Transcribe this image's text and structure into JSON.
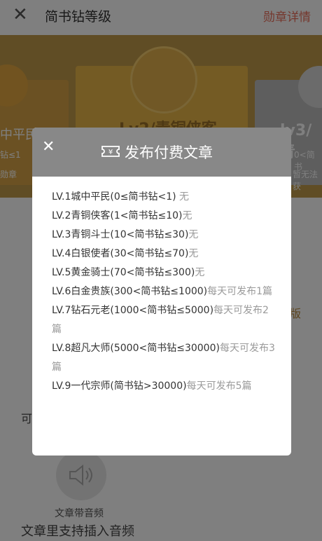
{
  "topbar": {
    "title": "简书钻等级",
    "right_link": "勋章详情"
  },
  "hero": {
    "left_level_text": "中平民",
    "left_range_text": "钻≤1",
    "left_sub_text": "勋章",
    "center_level_text": "Lv2/青铜侠客",
    "right_level_text": "lv3/青",
    "right_range_text": "0<简书",
    "right_sub_text": "暂无法获"
  },
  "background": {
    "right_char": "版",
    "left_char": "可",
    "audio_label": "文章带音频",
    "audio_caption": "文章里支持插入音频"
  },
  "modal": {
    "close_icon": "close-icon",
    "header_icon": "ticket-yuan-icon",
    "title": "发布付费文章",
    "levels": [
      {
        "name": "LV.1城中平民(0≤简书钻<1)",
        "perm": " 无"
      },
      {
        "name": "LV.2青铜侠客(1<简书钻≤10)",
        "perm": "无"
      },
      {
        "name": "LV.3青铜斗士(10<简书钻≤30)",
        "perm": "无"
      },
      {
        "name": "LV.4白银使者(30<简书钻≤70)",
        "perm": "无"
      },
      {
        "name": "LV.5黄金骑士(70<简书钻≤300)",
        "perm": "无"
      },
      {
        "name": "LV.6白金贵族(300<简书钻≤1000)",
        "perm": "每天可发布1篇"
      },
      {
        "name": "LV.7钻石元老(1000<简书钻≤5000)",
        "perm": "每天可发布2篇"
      },
      {
        "name": "LV.8超凡大师(5000<简书钻≤30000)",
        "perm": "每天可发布3篇"
      },
      {
        "name": "LV.9一代宗师(简书钻>30000)",
        "perm": "每天可发布5篇"
      }
    ]
  },
  "colors": {
    "accent": "#ea6f5a",
    "overlay": "rgba(0,0,0,0.5)",
    "modal_header": "#888888"
  }
}
